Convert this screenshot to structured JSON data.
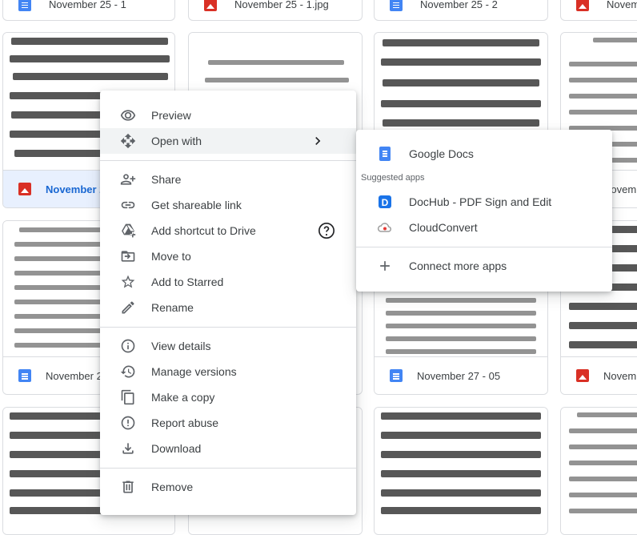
{
  "top_row": [
    {
      "name": "November 25 - 1",
      "type": "doc"
    },
    {
      "name": "November 25 - 1.jpg",
      "type": "image"
    },
    {
      "name": "November 25 - 2",
      "type": "doc"
    },
    {
      "name": "Novem",
      "type": "image"
    }
  ],
  "row2": [
    {
      "name": "November 2",
      "type": "image",
      "selected": true
    },
    {
      "name": "",
      "type": "doc"
    },
    {
      "name": "",
      "type": "doc"
    },
    {
      "name": "Novem",
      "type": "doc"
    }
  ],
  "row3": [
    {
      "name": "November 2",
      "type": "doc"
    },
    {
      "name": "",
      "type": "doc"
    },
    {
      "name": "November 27 - 05",
      "type": "doc"
    },
    {
      "name": "Novem",
      "type": "image"
    }
  ],
  "context_menu": {
    "items": [
      {
        "label": "Preview",
        "icon": "eye-icon"
      },
      {
        "label": "Open with",
        "icon": "move-arrows-icon"
      },
      {
        "label": "Share",
        "icon": "add-person-icon"
      },
      {
        "label": "Get shareable link",
        "icon": "link-icon"
      },
      {
        "label": "Add shortcut to Drive",
        "icon": "drive-shortcut-icon"
      },
      {
        "label": "Move to",
        "icon": "folder-move-icon"
      },
      {
        "label": "Add to Starred",
        "icon": "star-icon"
      },
      {
        "label": "Rename",
        "icon": "pencil-icon"
      },
      {
        "label": "View details",
        "icon": "info-icon"
      },
      {
        "label": "Manage versions",
        "icon": "history-icon"
      },
      {
        "label": "Make a copy",
        "icon": "copy-icon"
      },
      {
        "label": "Report abuse",
        "icon": "report-icon"
      },
      {
        "label": "Download",
        "icon": "download-icon"
      },
      {
        "label": "Remove",
        "icon": "trash-icon"
      }
    ]
  },
  "open_with_menu": {
    "google_docs": "Google Docs",
    "suggested_header": "Suggested apps",
    "dochub": "DocHub - PDF Sign and Edit",
    "cloudconvert": "CloudConvert",
    "connect": "Connect more apps"
  },
  "colors": {
    "accent": "#1a73e8",
    "selected_bg": "#e8f0fe",
    "doc_blue": "#4285f4",
    "image_red": "#d93025",
    "dochub_blue": "#1a73e8"
  }
}
